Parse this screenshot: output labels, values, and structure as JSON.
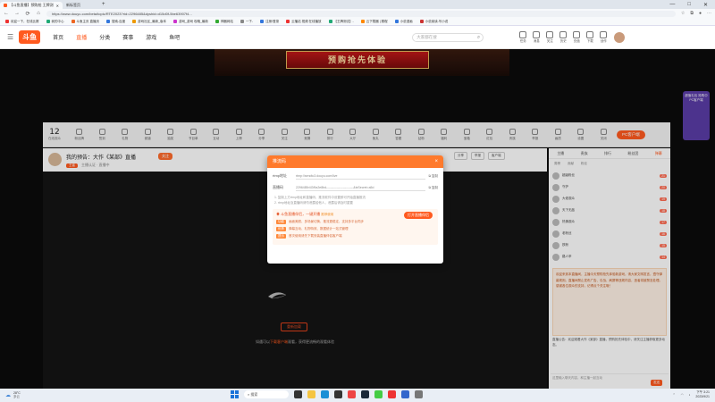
{
  "browser": {
    "active_tab": "【斗鱼直播】预购抢 王牌测试卡战斗测试服",
    "inactive_tab": "新标签页",
    "url": "https://www.douyu.com/beta/topic/RTE2023?rid=2296485&dyshid=d15d0f-5be63907f4...",
    "window_controls": [
      "—",
      "□",
      "✕"
    ]
  },
  "bookmarks": [
    {
      "label": "欢迎一下，在线比赛",
      "color": "#e33"
    },
    {
      "label": "我的中心",
      "color": "#2a7"
    },
    {
      "label": "斗鱼主页 直播页",
      "color": "#e62"
    },
    {
      "label": "搜索-百度",
      "color": "#37d"
    },
    {
      "label": "游戏社区_最新_版本",
      "color": "#e90"
    },
    {
      "label": "游戏_游戏 攻略_最新",
      "color": "#c3c"
    },
    {
      "label": "神器网站",
      "color": "#3a3"
    },
    {
      "label": "一下-",
      "color": "#888"
    },
    {
      "label": "注册/登录",
      "color": "#37d"
    },
    {
      "label": "云播站 视频 在线播放",
      "color": "#e33"
    },
    {
      "label": "【王牌测试】-",
      "color": "#2a7"
    },
    {
      "label": "云下载器 | 赛程",
      "color": "#f80"
    },
    {
      "label": "小说漫画",
      "color": "#37d"
    },
    {
      "label": "小说阅读-写小说",
      "color": "#c33"
    }
  ],
  "site": {
    "logo": "斗鱼",
    "nav": [
      "首页",
      "直播",
      "分类",
      "赛事",
      "游戏",
      "鱼吧"
    ],
    "active_nav": "直播",
    "search_placeholder": "大家都在搜",
    "header_icons": [
      {
        "label": "任务",
        "icon": "task-icon"
      },
      {
        "label": "消息",
        "icon": "bell-icon"
      },
      {
        "label": "关注",
        "icon": "heart-icon"
      },
      {
        "label": "历史",
        "icon": "clock-icon"
      },
      {
        "label": "充值",
        "icon": "wallet-icon"
      },
      {
        "label": "下载",
        "icon": "download-icon"
      },
      {
        "label": "创作",
        "icon": "pen-icon"
      }
    ]
  },
  "stage": {
    "banner_text": "预购抢先体验",
    "promo": "超值礼包 抢购中 PC客户端"
  },
  "toolbar": {
    "count": "12",
    "count_label": "在线观众",
    "items": [
      "粉丝牌",
      "签到",
      "礼物",
      "频道",
      "抽奖",
      "节目单",
      "互动",
      "上榜",
      "分享",
      "关注",
      "竞猜",
      "排行",
      "大厅",
      "鱼丸",
      "答题",
      "钻粉",
      "福利",
      "宝箱",
      "红包",
      "贵族",
      "举报",
      "画质",
      "设置",
      "关闭"
    ],
    "pc_button": "PC客户端"
  },
  "anchor": {
    "title": "我的预告：大作《某部》直播",
    "category": "王者",
    "meta": "主播认证 · 直播中",
    "follow": "关注",
    "buttons": [
      "分享",
      "举报",
      "客户端"
    ]
  },
  "video": {
    "retry": "重新加载",
    "hint_prefix": "如遇可以",
    "hint_link": "下载客户端",
    "hint_suffix": "观看，获得更流畅的观看体验"
  },
  "chat": {
    "tabs": [
      "主播",
      "贵族",
      "排行",
      "粉丝团",
      "弹幕"
    ],
    "active_tab": "弹幕",
    "sub_tabs": [
      "周榜",
      "贡献",
      "粉丝"
    ],
    "ranks": [
      {
        "name": "超级粉丝",
        "level": "21"
      },
      {
        "name": "守护",
        "level": "20"
      },
      {
        "name": "大佬观众",
        "level": "19"
      },
      {
        "name": "天下无敌",
        "level": "18"
      },
      {
        "name": "热情观众",
        "level": "17"
      },
      {
        "name": "老粉丝",
        "level": "16"
      },
      {
        "name": "铁粉",
        "level": "15"
      },
      {
        "name": "路人甲",
        "level": "14"
      }
    ],
    "orange_text": "欢迎来到本直播间，主播今天预购抢先体验新游戏，请大家文明发言，遵守弹幕规则。直播间禁止发布广告、引战、刷屏等违规内容，违者将被禁言处理。感谢各位观众的支持，记得点个关注哦！",
    "notice": "直播公告：欢迎观看大作《某部》直播，预购抢先体验中，请关注主播获取更多动态。",
    "input_placeholder": "这里输入聊天内容，和主播一起互动",
    "send": "发送"
  },
  "modal": {
    "title": "推流码",
    "label_url": "rtmp地址",
    "value_url": "rtmp://sendtc3.douyu.com/live",
    "label_key": "直播码",
    "value_key": "2296485r4Gf9a2e8bd--------------------------&txSecret=a5d",
    "copy": "复制",
    "note1": "1. 复制上方rtmp地址和直播码，推流软件中设置即可开始直播推流",
    "note2": "2. rtmp地址及直播码请勿泄露给他人，泄露后请及时重置",
    "promo_title": "斗鱼直播伴侣，一键开播",
    "promo_tag": "推荐使用",
    "open_button": "打开直播伴侣",
    "lines": [
      {
        "tag": "功能",
        "text": "画面美颜、多场景切换、推流更稳定、支持多平台同步"
      },
      {
        "tag": "优势",
        "text": "弹幕互动、礼物特效、数据统计一站式管理"
      },
      {
        "tag": "提示",
        "text": "首次使用请先下载安装直播伴侣客户端"
      }
    ]
  },
  "taskbar": {
    "weather_temp": "28°C",
    "weather_desc": "多云",
    "search": "搜索",
    "time": "下午 3:21",
    "date": "2023/9/21",
    "apps": [
      {
        "icon": "taskview-icon",
        "color": "#333"
      },
      {
        "icon": "files-icon",
        "color": "#f5c542"
      },
      {
        "icon": "edge-icon",
        "color": "#1a8fd6"
      },
      {
        "icon": "store-icon",
        "color": "#333"
      },
      {
        "icon": "chrome-icon",
        "color": "#e44"
      },
      {
        "icon": "steam-icon",
        "color": "#1b2838"
      },
      {
        "icon": "game-icon",
        "color": "#4c4"
      },
      {
        "icon": "music-icon",
        "color": "#e33"
      },
      {
        "icon": "mail-icon",
        "color": "#36c"
      },
      {
        "icon": "settings-icon",
        "color": "#777"
      }
    ]
  }
}
